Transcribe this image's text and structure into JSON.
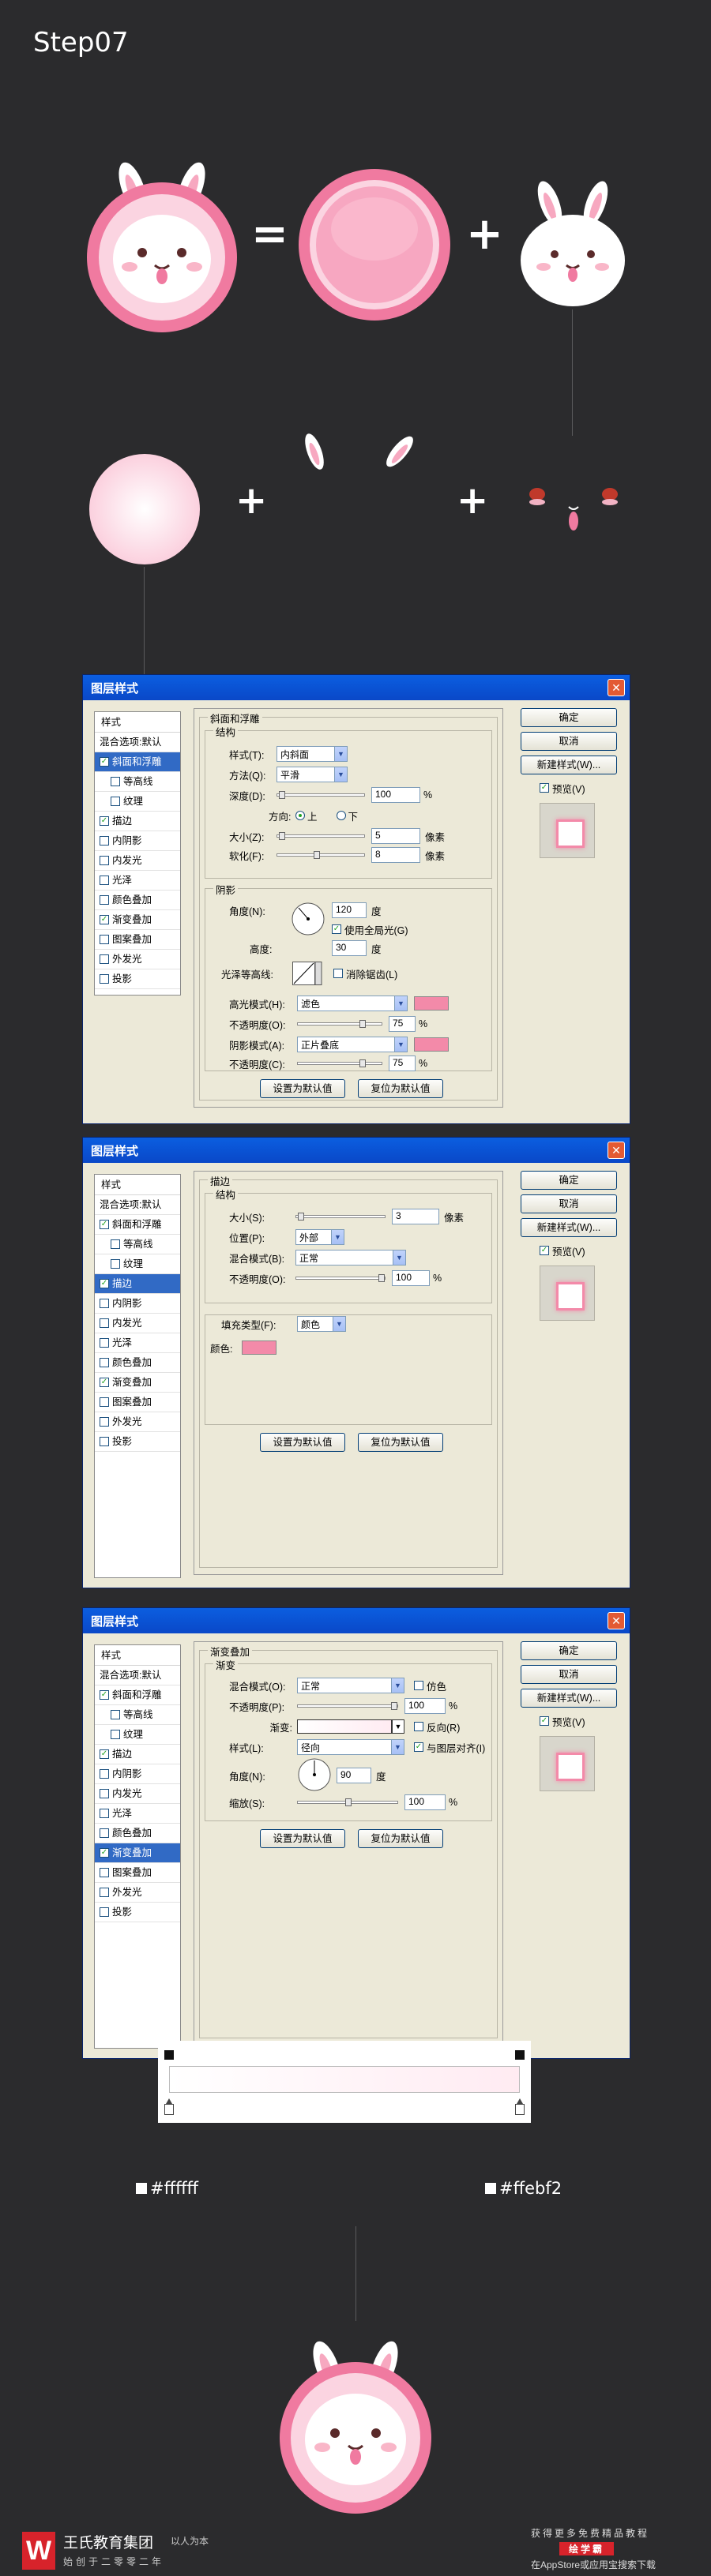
{
  "step_title": "Step07",
  "operators": {
    "equals": "=",
    "plus": "+"
  },
  "dialog1": {
    "title": "图层样式",
    "close": "✕",
    "list_header": "样式",
    "list_items": [
      {
        "label": "混合选项:默认",
        "check": false,
        "selected": false,
        "sub": false
      },
      {
        "label": "斜面和浮雕",
        "check": true,
        "selected": true,
        "sub": false
      },
      {
        "label": "等高线",
        "check": false,
        "selected": false,
        "sub": true
      },
      {
        "label": "纹理",
        "check": false,
        "selected": false,
        "sub": true
      },
      {
        "label": "描边",
        "check": true,
        "selected": false,
        "sub": false
      },
      {
        "label": "内阴影",
        "check": false,
        "selected": false,
        "sub": false
      },
      {
        "label": "内发光",
        "check": false,
        "selected": false,
        "sub": false
      },
      {
        "label": "光泽",
        "check": false,
        "selected": false,
        "sub": false
      },
      {
        "label": "颜色叠加",
        "check": false,
        "selected": false,
        "sub": false
      },
      {
        "label": "渐变叠加",
        "check": true,
        "selected": false,
        "sub": false
      },
      {
        "label": "图案叠加",
        "check": false,
        "selected": false,
        "sub": false
      },
      {
        "label": "外发光",
        "check": false,
        "selected": false,
        "sub": false
      },
      {
        "label": "投影",
        "check": false,
        "selected": false,
        "sub": false
      }
    ],
    "section_title": "斜面和浮雕",
    "structure_title": "结构",
    "style_label": "样式(T):",
    "style_value": "内斜面",
    "method_label": "方法(Q):",
    "method_value": "平滑",
    "depth_label": "深度(D):",
    "depth_value": "100",
    "depth_unit": "%",
    "direction_label": "方向:",
    "dir_up": "上",
    "dir_down": "下",
    "size_label": "大小(Z):",
    "size_value": "5",
    "size_unit": "像素",
    "soften_label": "软化(F):",
    "soften_value": "8",
    "soften_unit": "像素",
    "shading_title": "阴影",
    "angle_label": "角度(N):",
    "angle_value": "120",
    "angle_unit": "度",
    "global_light": "使用全局光(G)",
    "altitude_label": "高度:",
    "altitude_value": "30",
    "altitude_unit": "度",
    "gloss_label": "光泽等高线:",
    "antialias": "消除锯齿(L)",
    "highlight_label": "高光模式(H):",
    "highlight_value": "滤色",
    "opacity_label": "不透明度(O):",
    "hl_opacity": "75",
    "percent": "%",
    "shadow_label": "阴影模式(A):",
    "shadow_value": "正片叠底",
    "opacity2_label": "不透明度(C):",
    "sh_opacity": "75",
    "btn_default": "设置为默认值",
    "btn_reset": "复位为默认值",
    "ok": "确定",
    "cancel": "取消",
    "new_style": "新建样式(W)...",
    "preview": "预览(V)"
  },
  "dialog2": {
    "title": "图层样式",
    "close": "✕",
    "list_header": "样式",
    "list_items": [
      {
        "label": "混合选项:默认",
        "check": false,
        "selected": false,
        "sub": false
      },
      {
        "label": "斜面和浮雕",
        "check": true,
        "selected": false,
        "sub": false
      },
      {
        "label": "等高线",
        "check": false,
        "selected": false,
        "sub": true
      },
      {
        "label": "纹理",
        "check": false,
        "selected": false,
        "sub": true
      },
      {
        "label": "描边",
        "check": true,
        "selected": true,
        "sub": false
      },
      {
        "label": "内阴影",
        "check": false,
        "selected": false,
        "sub": false
      },
      {
        "label": "内发光",
        "check": false,
        "selected": false,
        "sub": false
      },
      {
        "label": "光泽",
        "check": false,
        "selected": false,
        "sub": false
      },
      {
        "label": "颜色叠加",
        "check": false,
        "selected": false,
        "sub": false
      },
      {
        "label": "渐变叠加",
        "check": true,
        "selected": false,
        "sub": false
      },
      {
        "label": "图案叠加",
        "check": false,
        "selected": false,
        "sub": false
      },
      {
        "label": "外发光",
        "check": false,
        "selected": false,
        "sub": false
      },
      {
        "label": "投影",
        "check": false,
        "selected": false,
        "sub": false
      }
    ],
    "section_title": "描边",
    "structure_title": "结构",
    "size_label": "大小(S):",
    "size_value": "3",
    "size_unit": "像素",
    "position_label": "位置(P):",
    "position_value": "外部",
    "blend_label": "混合模式(B):",
    "blend_value": "正常",
    "opacity_label": "不透明度(O):",
    "opacity_value": "100",
    "percent": "%",
    "fill_label": "填充类型(F):",
    "fill_value": "颜色",
    "color_label": "颜色:",
    "btn_default": "设置为默认值",
    "btn_reset": "复位为默认值",
    "ok": "确定",
    "cancel": "取消",
    "new_style": "新建样式(W)...",
    "preview": "预览(V)"
  },
  "dialog3": {
    "title": "图层样式",
    "close": "✕",
    "list_header": "样式",
    "list_items": [
      {
        "label": "混合选项:默认",
        "check": false,
        "selected": false,
        "sub": false
      },
      {
        "label": "斜面和浮雕",
        "check": true,
        "selected": false,
        "sub": false
      },
      {
        "label": "等高线",
        "check": false,
        "selected": false,
        "sub": true
      },
      {
        "label": "纹理",
        "check": false,
        "selected": false,
        "sub": true
      },
      {
        "label": "描边",
        "check": true,
        "selected": false,
        "sub": false
      },
      {
        "label": "内阴影",
        "check": false,
        "selected": false,
        "sub": false
      },
      {
        "label": "内发光",
        "check": false,
        "selected": false,
        "sub": false
      },
      {
        "label": "光泽",
        "check": false,
        "selected": false,
        "sub": false
      },
      {
        "label": "颜色叠加",
        "check": false,
        "selected": false,
        "sub": false
      },
      {
        "label": "渐变叠加",
        "check": true,
        "selected": true,
        "sub": false
      },
      {
        "label": "图案叠加",
        "check": false,
        "selected": false,
        "sub": false
      },
      {
        "label": "外发光",
        "check": false,
        "selected": false,
        "sub": false
      },
      {
        "label": "投影",
        "check": false,
        "selected": false,
        "sub": false
      }
    ],
    "section_title": "渐变叠加",
    "gradient_title": "渐变",
    "blend_label": "混合模式(O):",
    "blend_value": "正常",
    "dither": "仿色",
    "opacity_label": "不透明度(P):",
    "opacity_value": "100",
    "percent": "%",
    "gradient_label": "渐变:",
    "reverse": "反向(R)",
    "style_label": "样式(L):",
    "style_value": "径向",
    "align": "与图层对齐(I)",
    "angle_label": "角度(N):",
    "angle_value": "90",
    "angle_unit": "度",
    "scale_label": "缩放(S):",
    "scale_value": "100",
    "btn_default": "设置为默认值",
    "btn_reset": "复位为默认值",
    "ok": "确定",
    "cancel": "取消",
    "new_style": "新建样式(W)...",
    "preview": "预览(V)"
  },
  "gradient": {
    "left_hex": "#ffffff",
    "right_hex": "#ffebf2"
  },
  "footer": {
    "logo_glyph": "W",
    "name": "王氏教育集团",
    "motto": "以人为本",
    "sub": "始创于二零零二年",
    "right_line1": "获得更多免费精品教程",
    "right_badge": "绘学霸",
    "right_line3": "在AppStore或应用宝搜索下载"
  },
  "colors": {
    "background": "#2b2b2d",
    "accent_pink": "#f38aa9",
    "title_bar": "#0a48c8"
  }
}
